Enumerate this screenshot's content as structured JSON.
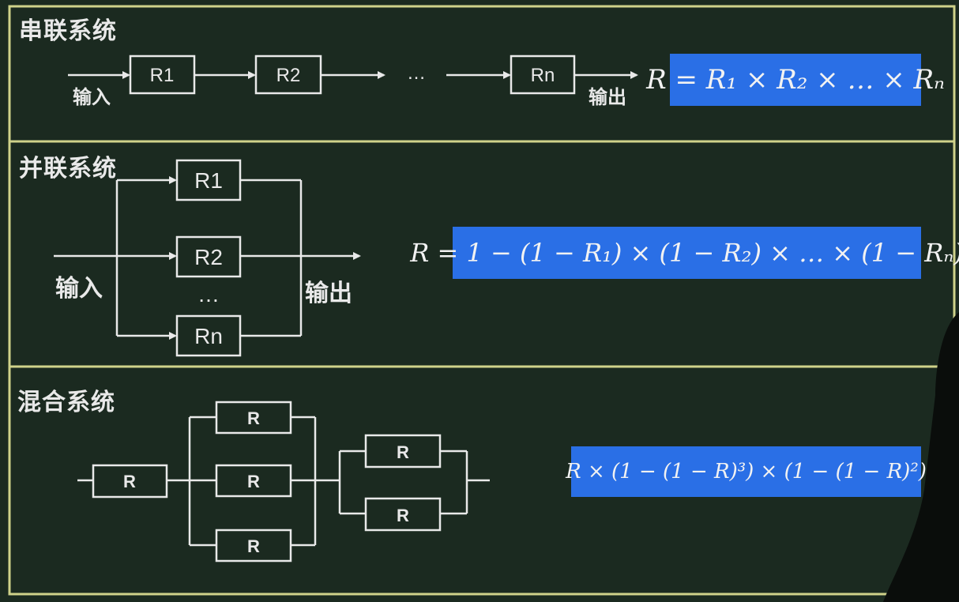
{
  "sections": {
    "series": {
      "title": "串联系统",
      "input": "输入",
      "output": "输出",
      "boxes": [
        "R1",
        "R2",
        "Rn"
      ],
      "ellipsis": "…",
      "formula": "R = R₁ × R₂ × … × Rₙ"
    },
    "parallel": {
      "title": "并联系统",
      "input": "输入",
      "output": "输出",
      "boxes": [
        "R1",
        "R2",
        "Rn"
      ],
      "ellipsis": "…",
      "formula": "R = 1 − (1 − R₁) × (1 − R₂) × … × (1 − Rₙ)"
    },
    "mixed": {
      "title": "混合系统",
      "box": "R",
      "formula": "R × (1 − (1 − R)³) × (1 − (1 − R)²)"
    }
  },
  "colors": {
    "board": "#1b2a20",
    "frame": "#cfd28a",
    "line": "#e9e9e9",
    "formula_bg": "#2a6fe6"
  }
}
